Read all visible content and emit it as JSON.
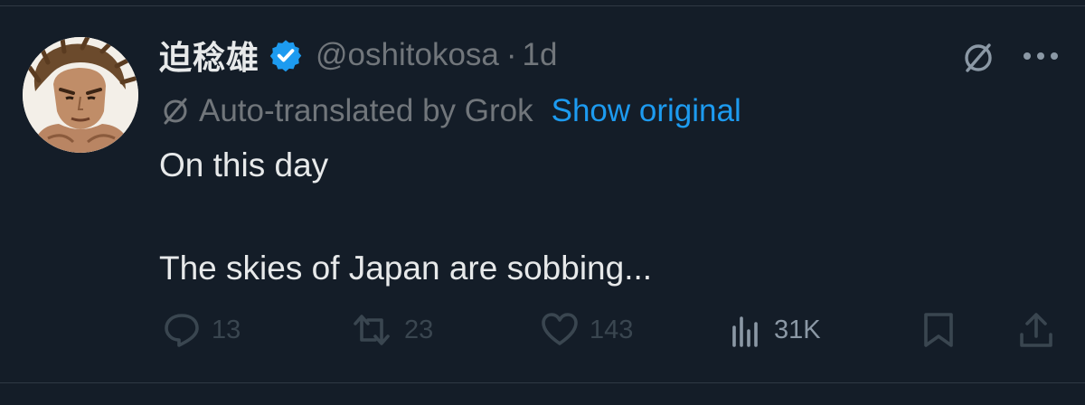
{
  "tweet": {
    "display_name": "迫稔雄",
    "handle": "@oshitokosa",
    "separator": "·",
    "age": "1d",
    "translation_note": "Auto-translated by Grok",
    "show_original_label": "Show original",
    "text_lines": [
      "On this day",
      "The skies of Japan are sobbing..."
    ]
  },
  "actions": {
    "replies": "13",
    "reposts": "23",
    "likes": "143",
    "views": "31K"
  },
  "colors": {
    "background": "#141d28",
    "text": "#e7e9ea",
    "muted": "#71767b",
    "link": "#1d9bf0",
    "verified": "#1d9bf0",
    "action_dim": "#3a4650"
  },
  "icons": {
    "verified": "verified-badge-icon",
    "grok": "grok-icon",
    "more": "more-dots-icon",
    "reply": "reply-icon",
    "repost": "repost-icon",
    "like": "heart-icon",
    "views": "views-chart-icon",
    "bookmark": "bookmark-icon",
    "share": "share-icon"
  }
}
